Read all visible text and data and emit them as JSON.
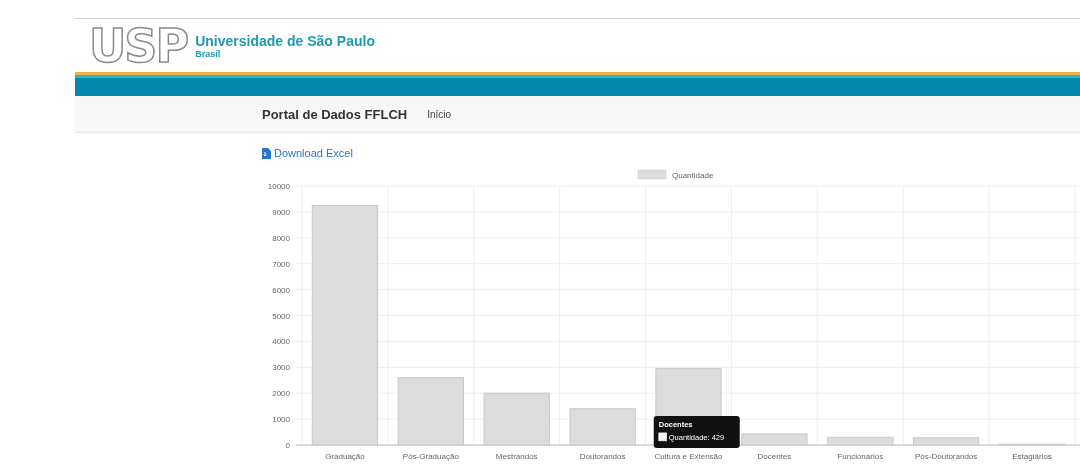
{
  "header": {
    "logo_text": "USP",
    "title": "Universidade de São Paulo",
    "subtitle": "Brasil"
  },
  "navbar": {
    "brand": "Portal de Dados FFLCH",
    "links": [
      {
        "label": "Início"
      }
    ]
  },
  "download_link": "Download Excel",
  "chart": {
    "chart_data": {
      "type": "bar",
      "categories": [
        "Graduação",
        "Pós-Graduação",
        "Mestrandos",
        "Doutorandos",
        "Cultura e Extensão",
        "Docentes",
        "Funcionários",
        "Pós-Doutorandos",
        "Estagiários"
      ],
      "series": [
        {
          "name": "Quantidade",
          "color": "#dcdcdc",
          "values": [
            9250,
            2600,
            2000,
            1400,
            2950,
            429,
            300,
            280,
            30
          ]
        }
      ],
      "ylim": [
        0,
        10000
      ],
      "grid": true,
      "yticks": [
        0,
        1000,
        2000,
        3000,
        4000,
        5000,
        6000,
        7000,
        8000,
        9000,
        10000
      ]
    },
    "tooltip": {
      "title": "Docentes",
      "label": "Quantidade: 429"
    }
  }
}
